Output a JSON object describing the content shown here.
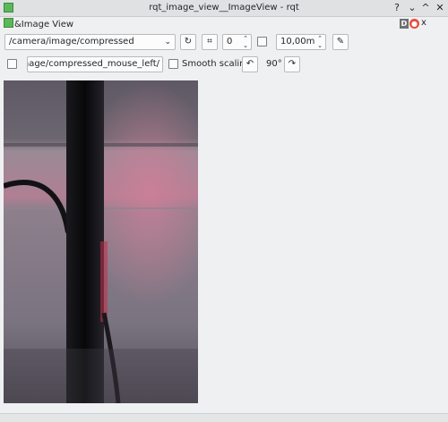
{
  "window": {
    "title": "rqt_image_view__ImageView - rqt",
    "controls": {
      "help": "?",
      "minimize": "^",
      "maximize": "^",
      "close": "x"
    }
  },
  "plugin": {
    "title": "&Image View",
    "d_label": "D",
    "help_icon": "lifebuoy-icon",
    "close_label": "x"
  },
  "toolbar": {
    "topic": "/camera/image/compressed",
    "refresh_icon": "refresh-icon",
    "fit_icon": "fit-icon",
    "spin_value": "0",
    "zoom_value": "10,00m",
    "save_icon": "save-icon",
    "mouse_topic": "/camera/image/compressed_mouse_left",
    "smooth_scaling_label": "Smooth scaling",
    "smooth_scaling_checked": false,
    "rotate_left_icon": "rotate-left-icon",
    "rotation": "90°",
    "rotate_right_icon": "rotate-right-icon"
  },
  "colors": {
    "background": "#eff0f1",
    "image_base": "#6a6570",
    "accent_red": "#c0304a"
  }
}
